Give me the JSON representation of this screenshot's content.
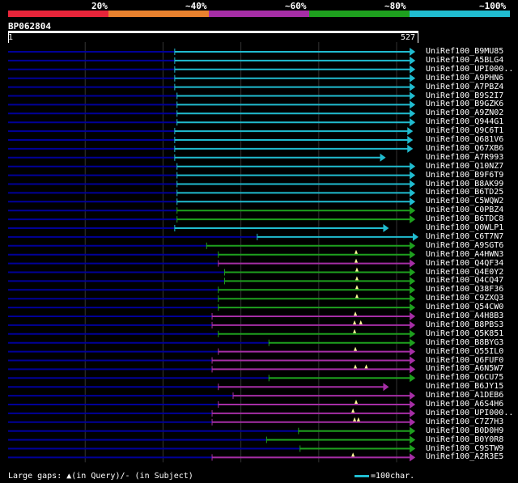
{
  "legend": {
    "labels": [
      "20%",
      "~40%",
      "~60%",
      "~80%",
      "~100%"
    ],
    "colors": [
      "#e8253a",
      "#e8812e",
      "#a62ea6",
      "#1ea01e",
      "#20bcd0"
    ]
  },
  "query": {
    "id": "BP062804",
    "start": "1",
    "end": "527",
    "length": 527
  },
  "colors": {
    "background": "#000000",
    "query_line": "#000099",
    "grid": "#333333",
    "gap_marker": "#ffff99"
  },
  "hits": [
    {
      "name": "UniRef100_B9MU85",
      "start": 215,
      "end": 523,
      "identity_band": "~100%",
      "gaps": []
    },
    {
      "name": "UniRef100_A5BLG4",
      "start": 215,
      "end": 523,
      "identity_band": "~100%",
      "gaps": []
    },
    {
      "name": "UniRef100_UPI000..",
      "start": 215,
      "end": 523,
      "identity_band": "~100%",
      "gaps": []
    },
    {
      "name": "UniRef100_A9PHN6",
      "start": 215,
      "end": 523,
      "identity_band": "~100%",
      "gaps": []
    },
    {
      "name": "UniRef100_A7PBZ4",
      "start": 215,
      "end": 523,
      "identity_band": "~100%",
      "gaps": []
    },
    {
      "name": "UniRef100_B9S2I7",
      "start": 218,
      "end": 523,
      "identity_band": "~100%",
      "gaps": []
    },
    {
      "name": "UniRef100_B9GZK6",
      "start": 218,
      "end": 523,
      "identity_band": "~100%",
      "gaps": []
    },
    {
      "name": "UniRef100_A9ZN02",
      "start": 218,
      "end": 523,
      "identity_band": "~100%",
      "gaps": []
    },
    {
      "name": "UniRef100_Q944G1",
      "start": 218,
      "end": 523,
      "identity_band": "~100%",
      "gaps": []
    },
    {
      "name": "UniRef100_Q9C6T1",
      "start": 215,
      "end": 520,
      "identity_band": "~100%",
      "gaps": []
    },
    {
      "name": "UniRef100_Q681V6",
      "start": 215,
      "end": 520,
      "identity_band": "~100%",
      "gaps": []
    },
    {
      "name": "UniRef100_Q67XB6",
      "start": 215,
      "end": 520,
      "identity_band": "~100%",
      "gaps": []
    },
    {
      "name": "UniRef100_A7R993",
      "start": 215,
      "end": 485,
      "identity_band": "~100%",
      "gaps": []
    },
    {
      "name": "UniRef100_Q10NZ7",
      "start": 218,
      "end": 523,
      "identity_band": "~100%",
      "gaps": []
    },
    {
      "name": "UniRef100_B9F6T9",
      "start": 218,
      "end": 523,
      "identity_band": "~100%",
      "gaps": []
    },
    {
      "name": "UniRef100_B8AK99",
      "start": 218,
      "end": 523,
      "identity_band": "~100%",
      "gaps": []
    },
    {
      "name": "UniRef100_B6TD25",
      "start": 218,
      "end": 523,
      "identity_band": "~100%",
      "gaps": []
    },
    {
      "name": "UniRef100_C5WQW2",
      "start": 218,
      "end": 523,
      "identity_band": "~100%",
      "gaps": []
    },
    {
      "name": "UniRef100_C0PBZ4",
      "start": 218,
      "end": 523,
      "identity_band": "~80%",
      "gaps": []
    },
    {
      "name": "UniRef100_B6TDC8",
      "start": 218,
      "end": 523,
      "identity_band": "~80%",
      "gaps": []
    },
    {
      "name": "UniRef100_Q0WLP1",
      "start": 215,
      "end": 489,
      "identity_band": "~100%",
      "gaps": []
    },
    {
      "name": "UniRef100_C6T7N7",
      "start": 321,
      "end": 527,
      "identity_band": "~100%",
      "gaps": []
    },
    {
      "name": "UniRef100_A9SGT6",
      "start": 256,
      "end": 523,
      "identity_band": "~80%",
      "gaps": []
    },
    {
      "name": "UniRef100_A4HWN3",
      "start": 271,
      "end": 523,
      "identity_band": "~80%",
      "gaps": [
        448
      ]
    },
    {
      "name": "UniRef100_Q4QF34",
      "start": 271,
      "end": 523,
      "identity_band": "~60%",
      "gaps": [
        448
      ]
    },
    {
      "name": "UniRef100_Q4E0Y2",
      "start": 279,
      "end": 523,
      "identity_band": "~80%",
      "gaps": [
        449
      ]
    },
    {
      "name": "UniRef100_Q4CQ47",
      "start": 279,
      "end": 523,
      "identity_band": "~80%",
      "gaps": [
        449
      ]
    },
    {
      "name": "UniRef100_Q38F36",
      "start": 271,
      "end": 523,
      "identity_band": "~80%",
      "gaps": [
        449
      ]
    },
    {
      "name": "UniRef100_C9ZXQ3",
      "start": 271,
      "end": 523,
      "identity_band": "~80%",
      "gaps": [
        449
      ]
    },
    {
      "name": "UniRef100_Q54CW0",
      "start": 271,
      "end": 523,
      "identity_band": "~80%",
      "gaps": []
    },
    {
      "name": "UniRef100_A4H8B3",
      "start": 263,
      "end": 523,
      "identity_band": "~60%",
      "gaps": [
        447
      ]
    },
    {
      "name": "UniRef100_B8PBS3",
      "start": 263,
      "end": 523,
      "identity_band": "~60%",
      "gaps": [
        446,
        454
      ]
    },
    {
      "name": "UniRef100_Q5K851",
      "start": 271,
      "end": 523,
      "identity_band": "~80%",
      "gaps": [
        446
      ]
    },
    {
      "name": "UniRef100_B8BYG3",
      "start": 336,
      "end": 523,
      "identity_band": "~80%",
      "gaps": []
    },
    {
      "name": "UniRef100_Q55IL0",
      "start": 271,
      "end": 523,
      "identity_band": "~60%",
      "gaps": [
        447
      ]
    },
    {
      "name": "UniRef100_Q6FUF0",
      "start": 263,
      "end": 523,
      "identity_band": "~60%",
      "gaps": []
    },
    {
      "name": "UniRef100_A6N5W7",
      "start": 263,
      "end": 523,
      "identity_band": "~60%",
      "gaps": [
        447,
        461
      ]
    },
    {
      "name": "UniRef100_Q6CU75",
      "start": 336,
      "end": 523,
      "identity_band": "~80%",
      "gaps": []
    },
    {
      "name": "UniRef100_B6JY15",
      "start": 271,
      "end": 489,
      "identity_band": "~60%",
      "gaps": []
    },
    {
      "name": "UniRef100_A1DEB6",
      "start": 290,
      "end": 523,
      "identity_band": "~60%",
      "gaps": []
    },
    {
      "name": "UniRef100_A6S4H6",
      "start": 271,
      "end": 523,
      "identity_band": "~60%",
      "gaps": [
        448
      ]
    },
    {
      "name": "UniRef100_UPI000..",
      "start": 263,
      "end": 523,
      "identity_band": "~60%",
      "gaps": [
        444
      ]
    },
    {
      "name": "UniRef100_C7Z7H3",
      "start": 263,
      "end": 523,
      "identity_band": "~60%",
      "gaps": [
        446,
        451
      ]
    },
    {
      "name": "UniRef100_B0D0H9",
      "start": 374,
      "end": 523,
      "identity_band": "~80%",
      "gaps": []
    },
    {
      "name": "UniRef100_B0Y0R8",
      "start": 333,
      "end": 523,
      "identity_band": "~80%",
      "gaps": []
    },
    {
      "name": "UniRef100_C9STW9",
      "start": 376,
      "end": 523,
      "identity_band": "~80%",
      "gaps": []
    },
    {
      "name": "UniRef100_A2R3E5",
      "start": 263,
      "end": 523,
      "identity_band": "~60%",
      "gaps": [
        444
      ]
    }
  ],
  "footer": {
    "gaps_legend": "Large gaps: ▲(in Query)/- (in Subject)",
    "scale_label": "=100char."
  }
}
